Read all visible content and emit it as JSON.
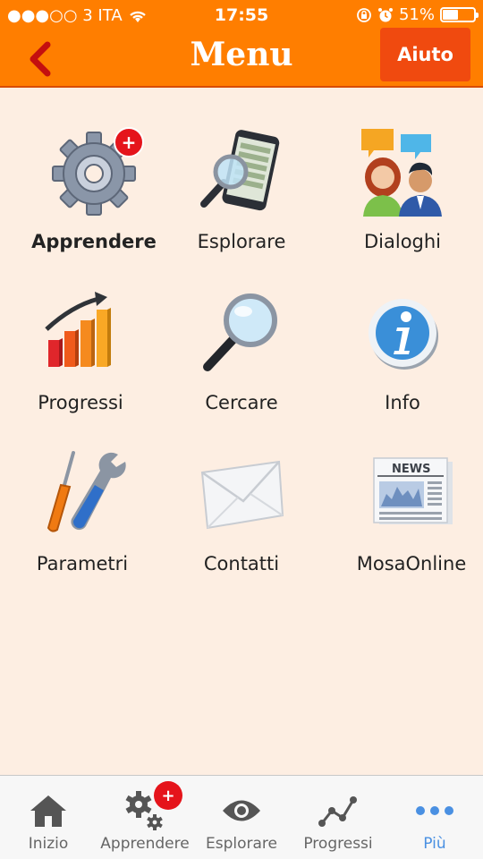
{
  "status_bar": {
    "carrier": "●●●○○ 3 ITA",
    "time": "17:55",
    "battery": "51%",
    "battery_level": 0.51
  },
  "nav": {
    "title": "Menu",
    "help_label": "Aiuto"
  },
  "menu": {
    "items": [
      {
        "label": "Apprendere",
        "icon": "gear-icon",
        "badge": "+"
      },
      {
        "label": "Esplorare",
        "icon": "phone-magnifier-icon"
      },
      {
        "label": "Dialoghi",
        "icon": "people-speech-icon"
      },
      {
        "label": "Progressi",
        "icon": "bar-chart-icon"
      },
      {
        "label": "Cercare",
        "icon": "magnifier-icon"
      },
      {
        "label": "Info",
        "icon": "info-icon"
      },
      {
        "label": "Parametri",
        "icon": "tools-icon"
      },
      {
        "label": "Contatti",
        "icon": "envelope-icon"
      },
      {
        "label": "MosaOnline",
        "icon": "newspaper-icon"
      }
    ],
    "news_text": "NEWS"
  },
  "tabs": [
    {
      "label": "Inizio",
      "icon": "home-icon"
    },
    {
      "label": "Apprendere",
      "icon": "gears-icon",
      "badge": "+"
    },
    {
      "label": "Esplorare",
      "icon": "eye-icon"
    },
    {
      "label": "Progressi",
      "icon": "line-chart-icon"
    },
    {
      "label": "Più",
      "icon": "more-icon"
    }
  ],
  "colors": {
    "accent": "#ff7e00",
    "help_button": "#f04a0f",
    "background": "#fdeee2",
    "badge": "#e5141b",
    "active_tab": "#4a90e2"
  }
}
